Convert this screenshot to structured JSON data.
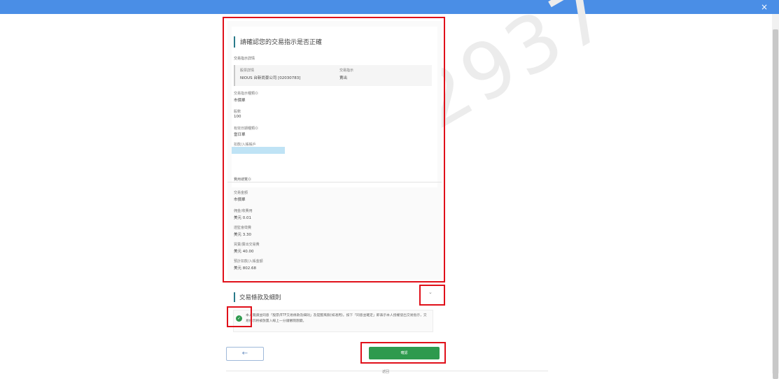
{
  "window": {
    "close_glyph": "×"
  },
  "watermark": "2012937",
  "confirm_panel": {
    "title": "請確認您的交易指示是否正確",
    "section_label": "交易指示詳情",
    "stock_name_label": "股票詳情",
    "stock_name_value": "NIOUS 台新尚豪公司 [02030783]",
    "instruction_label": "交易指示",
    "instruction_value": "賣出",
    "order_type_label": "交易指示種類⓪",
    "order_type_value": "市價單",
    "quantity_label": "股數",
    "quantity_value": "100",
    "validity_label": "有效日期種類⓪",
    "validity_value": "當日單",
    "account_label": "扣款/入帳帳戶",
    "summary_label": "費用總覽⓪",
    "trade_amount_label": "交易金額",
    "trade_amount_value": "市價單",
    "fee1_label": "佣金/收費用",
    "fee1_value": "美元 0.01",
    "fee2_label": "證監會徵費",
    "fee2_value": "美元 3.30",
    "fee3_label": "買賣/賣出交易費",
    "fee3_value": "美元 40.00",
    "total_label": "預計扣款/入帳金額",
    "total_value": "美元 802.68"
  },
  "terms": {
    "title": "交易條款及細則",
    "chevron": "⌄",
    "checkbox_glyph": "✓",
    "agree_text": "本人閱讀並同意「股票/ETF交易條款及細則」及提醒風險(如適用)。按下「同意並確定」即表示本人授權發出交易指示，交易指示將被放置入線上一分鐘審閱施變。"
  },
  "actions": {
    "back_glyph": "←",
    "confirm_label": "確認"
  },
  "footer": {
    "text": "返回"
  },
  "colors": {
    "accent_blue": "#4a8ee6",
    "confirm_green": "#2e9a4e",
    "annotation_red": "#e0101a"
  }
}
